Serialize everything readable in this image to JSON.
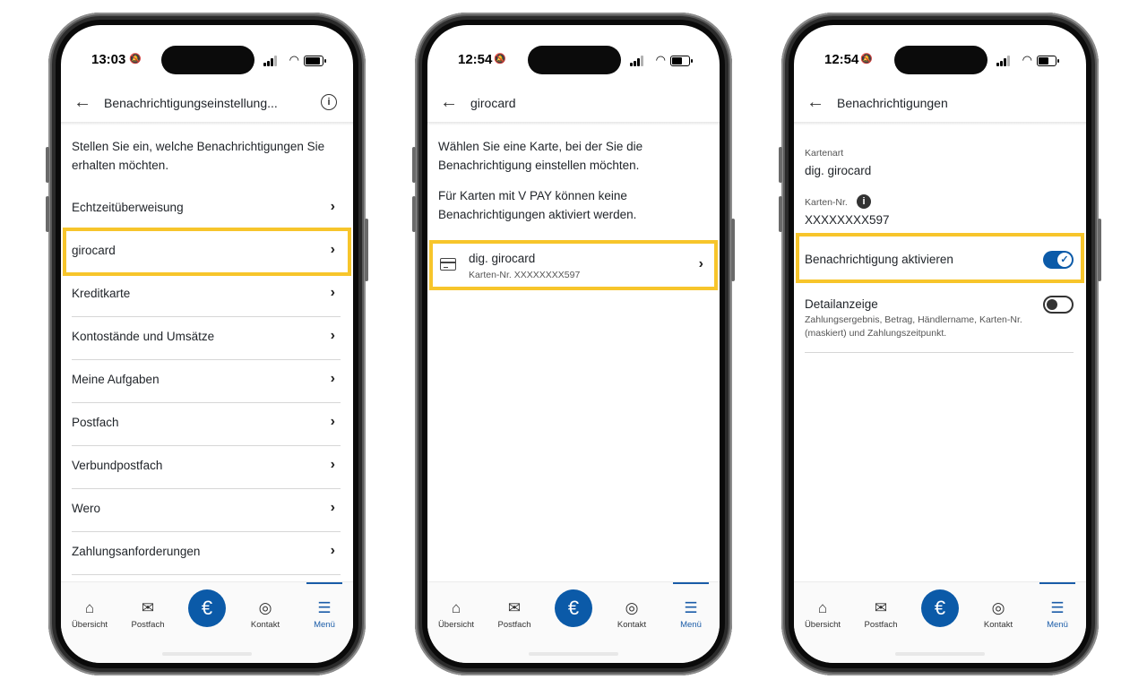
{
  "tabbar": {
    "tabs": [
      {
        "label": "Übersicht",
        "icon": "home-icon"
      },
      {
        "label": "Postfach",
        "icon": "mail-icon"
      },
      {
        "label": "Kontakt",
        "icon": "headset-icon"
      },
      {
        "label": "Menü",
        "icon": "menu-icon"
      }
    ],
    "center_icon": "€",
    "active_color": "#1a5ca8"
  },
  "highlight_color": "#f7c52b",
  "screen1": {
    "time": "13:03",
    "title": "Benachrichtigungseinstellung...",
    "intro": "Stellen Sie ein, welche Benachrichtigungen Sie erhalten möchten.",
    "items": [
      "Echtzeitüberweisung",
      "girocard",
      "Kreditkarte",
      "Kontostände und Umsätze",
      "Meine Aufgaben",
      "Postfach",
      "Verbundpostfach",
      "Wero",
      "Zahlungsanforderungen"
    ]
  },
  "screen2": {
    "time": "12:54",
    "title": "girocard",
    "intro1": "Wählen Sie eine Karte, bei der Sie die Benachrichtigung einstellen möchten.",
    "intro2": "Für Karten mit V PAY können keine Benachrichtigungen aktiviert werden.",
    "card_title": "dig. girocard",
    "card_sub": "Karten-Nr. XXXXXXXX597"
  },
  "screen3": {
    "time": "12:54",
    "title": "Benachrichtigungen",
    "kartenart_label": "Kartenart",
    "kartenart_value": "dig. girocard",
    "kartennr_label": "Karten-Nr.",
    "kartennr_value": "XXXXXXXX597",
    "activate_label": "Benachrichtigung aktivieren",
    "activate_on": true,
    "detail_label": "Detailanzeige",
    "detail_desc": "Zahlungsergebnis, Betrag, Händlername, Karten-Nr. (maskiert) und Zahlungszeitpunkt.",
    "detail_on": false
  }
}
